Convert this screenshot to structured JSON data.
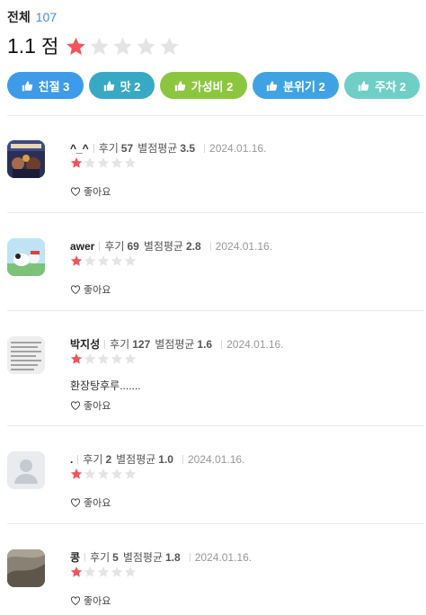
{
  "header": {
    "title": "전체",
    "count": "107"
  },
  "rating": {
    "score": "1.1",
    "unit": "점",
    "stars_filled": 1,
    "stars_total": 5
  },
  "tags": [
    {
      "icon": "thumbs-up-icon",
      "label": "친절 3",
      "color": "#3d9be9"
    },
    {
      "icon": "thumbs-up-icon",
      "label": "맛 2",
      "color": "#38a9c4"
    },
    {
      "icon": "thumbs-up-icon",
      "label": "가성비 2",
      "color": "#8cc63f"
    },
    {
      "icon": "thumbs-up-icon",
      "label": "분위기 2",
      "color": "#3fa3e3"
    },
    {
      "icon": "thumbs-up-icon",
      "label": "주차 2",
      "color": "#6fcfc6"
    }
  ],
  "reviews": [
    {
      "name": "^_^",
      "review_label": "후기",
      "review_count": "57",
      "avg_label": "별점평균",
      "avg": "3.5",
      "date": "2024.01.16.",
      "stars_filled": 1,
      "comment": "",
      "like_label": "좋아요"
    },
    {
      "name": "awer",
      "review_label": "후기",
      "review_count": "69",
      "avg_label": "별점평균",
      "avg": "2.8",
      "date": "2024.01.16.",
      "stars_filled": 1,
      "comment": "",
      "like_label": "좋아요"
    },
    {
      "name": "박지성",
      "review_label": "후기",
      "review_count": "127",
      "avg_label": "별점평균",
      "avg": "1.6",
      "date": "2024.01.16.",
      "stars_filled": 1,
      "comment": "환장탕후루.......",
      "like_label": "좋아요"
    },
    {
      "name": ".",
      "review_label": "후기",
      "review_count": "2",
      "avg_label": "별점평균",
      "avg": "1.0",
      "date": "2024.01.16.",
      "stars_filled": 1,
      "comment": "",
      "like_label": "좋아요"
    },
    {
      "name": "콩",
      "review_label": "후기",
      "review_count": "5",
      "avg_label": "별점평균",
      "avg": "1.8",
      "date": "2024.01.16.",
      "stars_filled": 1,
      "comment": "",
      "like_label": "좋아요"
    }
  ],
  "colors": {
    "star_on": "#f2545b",
    "star_off": "#e4e4e4",
    "accent": "#3d8ee8"
  }
}
